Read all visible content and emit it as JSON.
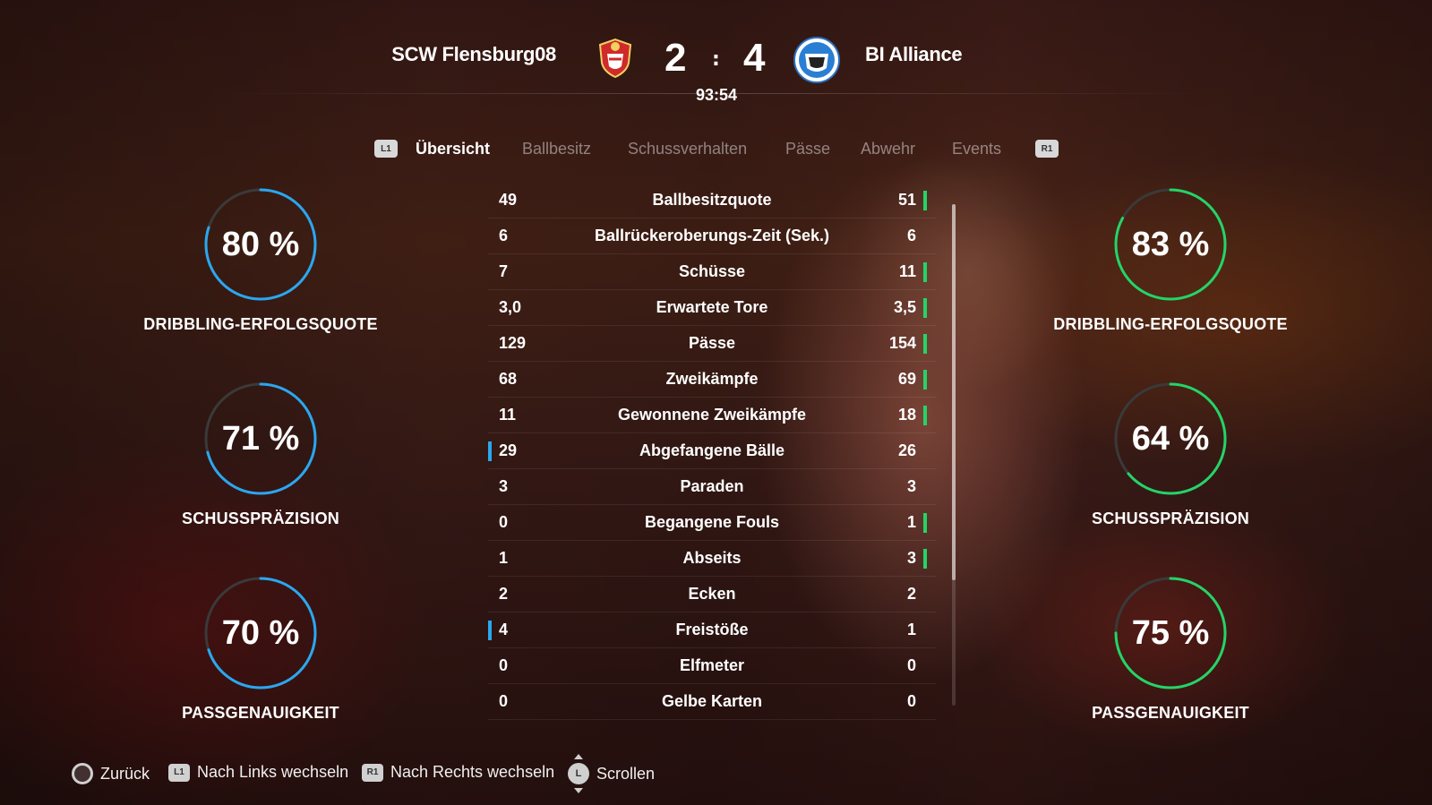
{
  "match": {
    "home_team": "SCW Flensburg08",
    "away_team": "BI Alliance",
    "home_score": "2",
    "separator": ":",
    "away_score": "4",
    "clock": "93:54"
  },
  "tabs": {
    "left_button": "L1",
    "right_button": "R1",
    "items": [
      "Übersicht",
      "Ballbesitz",
      "Schussverhalten",
      "Pässe",
      "Abwehr",
      "Events"
    ],
    "active": "Übersicht"
  },
  "home_rings": [
    {
      "value": "80 %",
      "fraction": 0.8,
      "label": "DRIBBLING-ERFOLGSQUOTE"
    },
    {
      "value": "71 %",
      "fraction": 0.71,
      "label": "SCHUSSPRÄZISION"
    },
    {
      "value": "70 %",
      "fraction": 0.7,
      "label": "PASSGENAUIGKEIT"
    }
  ],
  "away_rings": [
    {
      "value": "83 %",
      "fraction": 0.83,
      "label": "DRIBBLING-ERFOLGSQUOTE"
    },
    {
      "value": "64 %",
      "fraction": 0.64,
      "label": "SCHUSSPRÄZISION"
    },
    {
      "value": "75 %",
      "fraction": 0.75,
      "label": "PASSGENAUIGKEIT"
    }
  ],
  "colors": {
    "home_accent": "#2aa7f0",
    "away_accent": "#24d466",
    "ring_track": "#3a3a3a"
  },
  "stats": [
    {
      "name": "Ballbesitzquote",
      "home": "49",
      "away": "51",
      "leader": "away"
    },
    {
      "name": "Ballrückeroberungs-Zeit (Sek.)",
      "home": "6",
      "away": "6",
      "leader": "none"
    },
    {
      "name": "Schüsse",
      "home": "7",
      "away": "11",
      "leader": "away"
    },
    {
      "name": "Erwartete Tore",
      "home": "3,0",
      "away": "3,5",
      "leader": "away"
    },
    {
      "name": "Pässe",
      "home": "129",
      "away": "154",
      "leader": "away"
    },
    {
      "name": "Zweikämpfe",
      "home": "68",
      "away": "69",
      "leader": "away"
    },
    {
      "name": "Gewonnene Zweikämpfe",
      "home": "11",
      "away": "18",
      "leader": "away"
    },
    {
      "name": "Abgefangene Bälle",
      "home": "29",
      "away": "26",
      "leader": "home"
    },
    {
      "name": "Paraden",
      "home": "3",
      "away": "3",
      "leader": "none"
    },
    {
      "name": "Begangene Fouls",
      "home": "0",
      "away": "1",
      "leader": "away"
    },
    {
      "name": "Abseits",
      "home": "1",
      "away": "3",
      "leader": "away"
    },
    {
      "name": "Ecken",
      "home": "2",
      "away": "2",
      "leader": "none"
    },
    {
      "name": "Freistöße",
      "home": "4",
      "away": "1",
      "leader": "home"
    },
    {
      "name": "Elfmeter",
      "home": "0",
      "away": "0",
      "leader": "none"
    },
    {
      "name": "Gelbe Karten",
      "home": "0",
      "away": "0",
      "leader": "none"
    }
  ],
  "footer": {
    "back": "Zurück",
    "left_btn": "L1",
    "left_label": "Nach Links wechseln",
    "right_btn": "R1",
    "right_label": "Nach Rechts wechseln",
    "scroll_btn": "L",
    "scroll_label": "Scrollen"
  }
}
